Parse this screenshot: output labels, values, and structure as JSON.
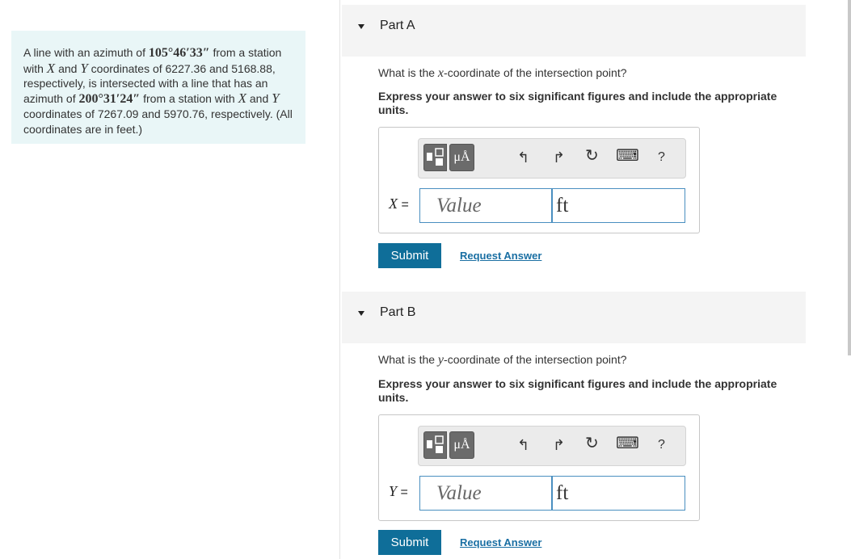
{
  "problem": {
    "t1": "A line with an azimuth of ",
    "az1": "105°46′33″",
    "t2": " from a station with ",
    "x": "X",
    "t3": " and ",
    "y": "Y",
    "t4": " coordinates of 6227.36 and 5168.88, respectively, is intersected with a line that has an azimuth of ",
    "az2": "200°31′24″",
    "t5": " from a station with ",
    "t6": " and ",
    "t7": " coordinates of 7267.09 and 5970.76, respectively. (All coordinates are in feet.)"
  },
  "toolbar": {
    "unit_symbol": "μÅ",
    "undo_symbol": "↰",
    "redo_symbol": "↱",
    "reset_symbol": "↻",
    "keyboard_symbol": "⌨",
    "help_symbol": "?"
  },
  "parts": [
    {
      "title": "Part A",
      "question_pre": "What is the ",
      "question_var": "x",
      "question_post": "-coordinate of the intersection point?",
      "instruction": "Express your answer to six significant figures and include the appropriate units.",
      "var_symbol": "X",
      "equals": " =",
      "value_placeholder": "Value",
      "unit_value": "ft",
      "submit_label": "Submit",
      "request_label": "Request Answer"
    },
    {
      "title": "Part B",
      "question_pre": "What is the ",
      "question_var": "y",
      "question_post": "-coordinate of the intersection point?",
      "instruction": "Express your answer to six significant figures and include the appropriate units.",
      "var_symbol": "Y",
      "equals": " =",
      "value_placeholder": "Value",
      "unit_value": "ft",
      "submit_label": "Submit",
      "request_label": "Request Answer"
    }
  ]
}
